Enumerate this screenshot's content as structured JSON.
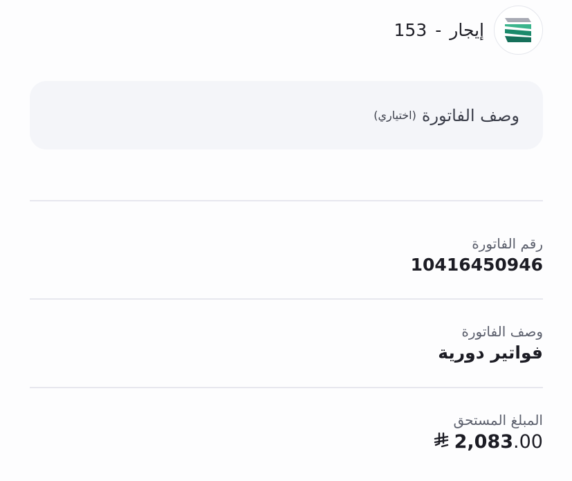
{
  "header": {
    "code": "153",
    "separator": "-",
    "name": "إيجار",
    "logo_icon": "biller-logo-icon",
    "logo_colors": [
      "#1b8a6b",
      "#3bb48c",
      "#a8aab4"
    ]
  },
  "description_input": {
    "label": "وصف الفاتورة",
    "optional": "(اختياري)"
  },
  "details": [
    {
      "label": "رقم الفاتورة",
      "value": "10416450946"
    },
    {
      "label": "وصف الفاتورة",
      "value": "فواتير دورية"
    }
  ],
  "amount": {
    "label": "المبلغ المستحق",
    "integer": "2,083",
    "decimal": ".00",
    "currency_icon": "saudi-riyal-icon"
  }
}
